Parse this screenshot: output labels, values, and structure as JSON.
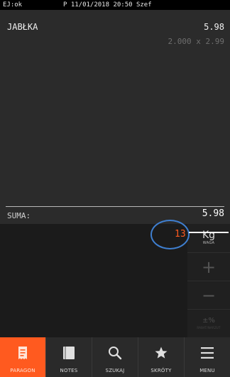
{
  "status": {
    "left": "EJ:ok",
    "center": "P 11/01/2018 20:50 Szef"
  },
  "receipt": {
    "item_name": "JABŁKA",
    "item_price": "5.98",
    "item_qty": "2.000 x 2.99",
    "sum_label": "SUMA:",
    "sum_value": "5.98"
  },
  "qty_display": "13",
  "unit": {
    "label": "Kg",
    "caption": "WAGA"
  },
  "side_buttons": {
    "plus": "+",
    "minus": "−",
    "discount": "±%",
    "discount_caption": "RABAT/NARZUT"
  },
  "nav": [
    {
      "label": "PARAGON",
      "icon": "receipt-icon",
      "active": true
    },
    {
      "label": "NOTES",
      "icon": "notes-icon",
      "active": false
    },
    {
      "label": "SZUKAJ",
      "icon": "search-icon",
      "active": false
    },
    {
      "label": "SKRÓTY",
      "icon": "star-icon",
      "active": false
    },
    {
      "label": "MENU",
      "icon": "menu-icon",
      "active": false
    }
  ],
  "colors": {
    "accent": "#ff5a1f",
    "highlight": "#3f7fd0"
  }
}
